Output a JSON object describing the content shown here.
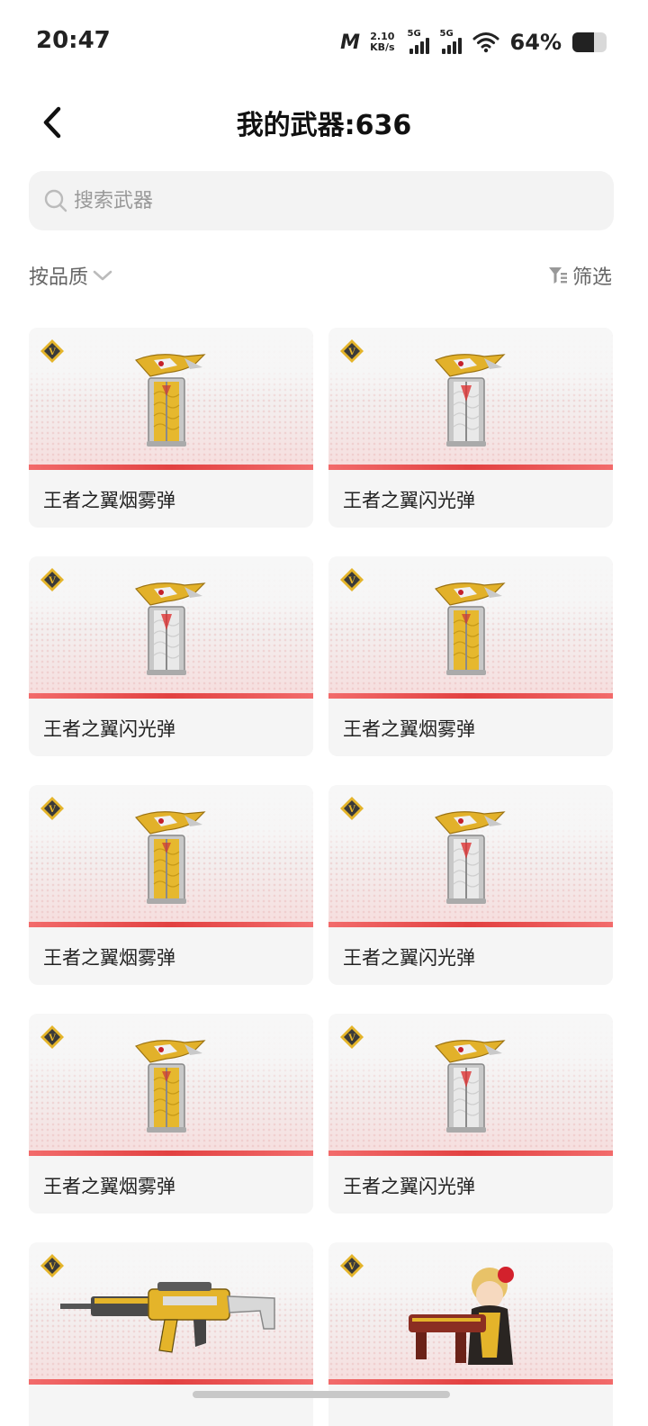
{
  "status_bar": {
    "time": "20:47",
    "carrier_logo": "m-logo",
    "net_speed_value": "2.10",
    "net_speed_unit": "KB/s",
    "sim1_tag": "5G",
    "sim2_tag": "5G",
    "wifi_icon": "wifi-icon",
    "battery_percent": "64%",
    "battery_level": 0.64
  },
  "header": {
    "back_icon": "chevron-left-icon",
    "title": "我的武器:636"
  },
  "search": {
    "placeholder": "搜索武器",
    "value": ""
  },
  "toolbar": {
    "sort_label": "按品质",
    "filter_label": "筛选"
  },
  "items": [
    {
      "name": "王者之翼烟雾弹",
      "kind": "smoke"
    },
    {
      "name": "王者之翼闪光弹",
      "kind": "flash"
    },
    {
      "name": "王者之翼闪光弹",
      "kind": "flash"
    },
    {
      "name": "王者之翼烟雾弹",
      "kind": "smoke"
    },
    {
      "name": "王者之翼烟雾弹",
      "kind": "smoke"
    },
    {
      "name": "王者之翼闪光弹",
      "kind": "flash"
    },
    {
      "name": "王者之翼烟雾弹",
      "kind": "smoke"
    },
    {
      "name": "王者之翼闪光弹",
      "kind": "flash"
    },
    {
      "name": "",
      "kind": "rifle"
    },
    {
      "name": "",
      "kind": "character"
    }
  ],
  "colors": {
    "accent_red": "#e24141",
    "gold": "#e4b42a"
  }
}
